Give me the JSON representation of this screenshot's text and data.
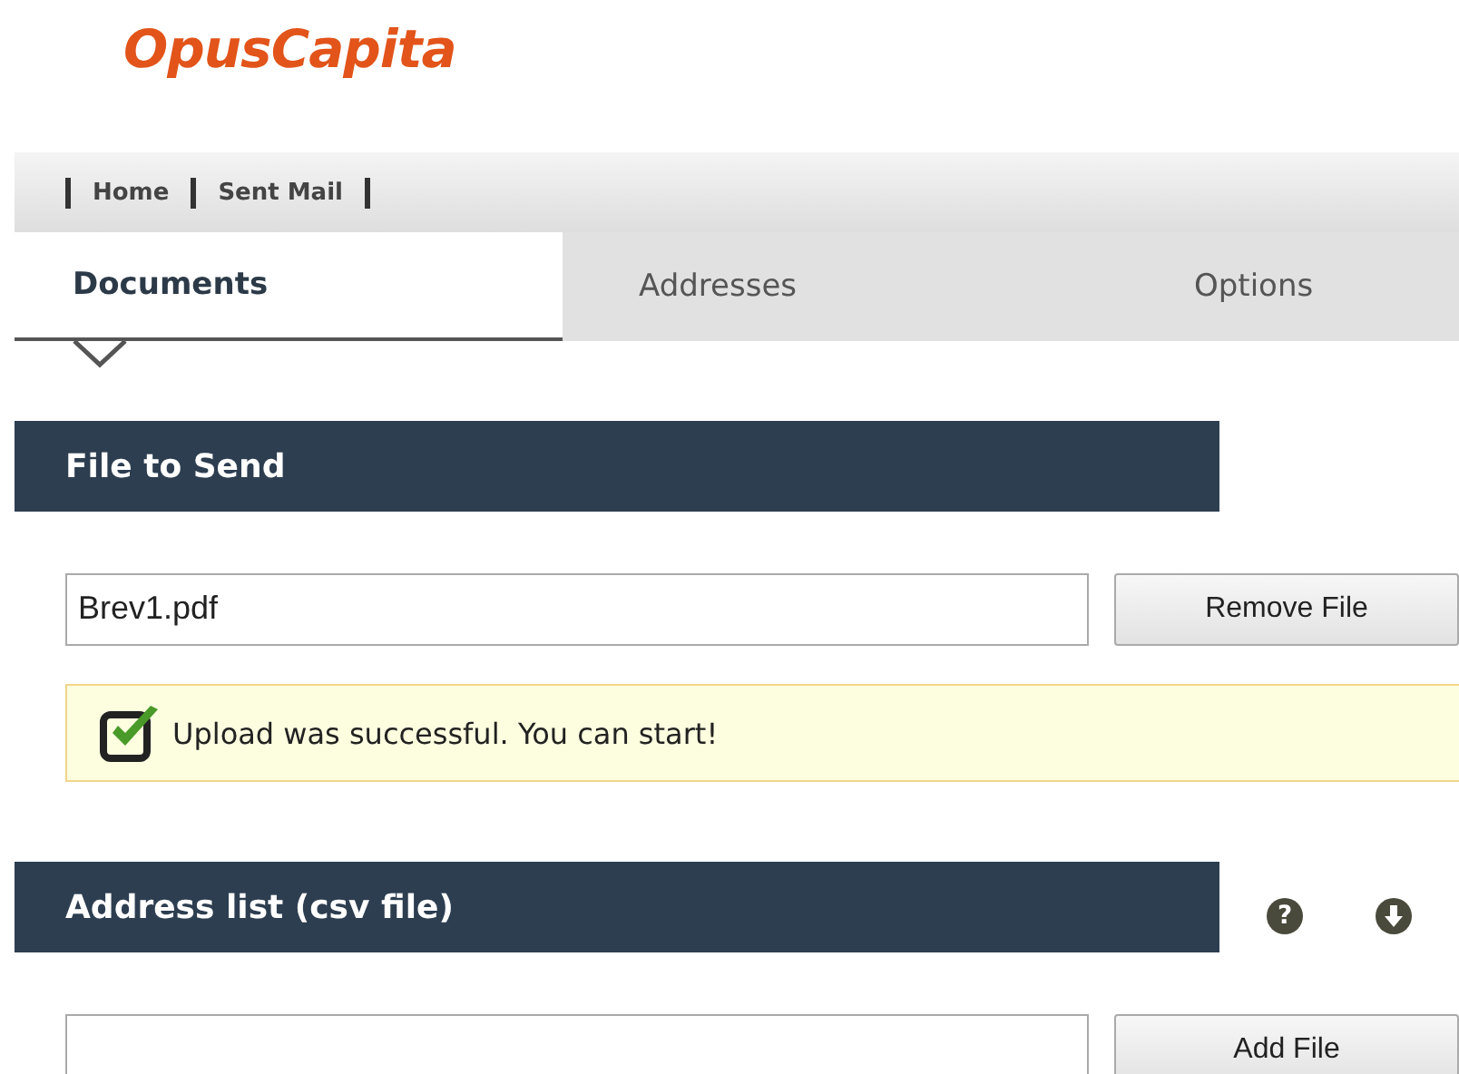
{
  "logo": "OpusCapita",
  "nav": [
    {
      "label": "Home"
    },
    {
      "label": "Sent Mail"
    }
  ],
  "tabs": [
    {
      "label": "Documents",
      "selected": true
    },
    {
      "label": "Addresses",
      "selected": false
    },
    {
      "label": "Options",
      "selected": false
    }
  ],
  "file_section": {
    "title": "File to Send",
    "value": "Brev1.pdf",
    "button": "Remove File",
    "message": "Upload was successful. You can start!"
  },
  "address_section": {
    "title": "Address list (csv file)",
    "help": "?",
    "button": "Add File"
  }
}
